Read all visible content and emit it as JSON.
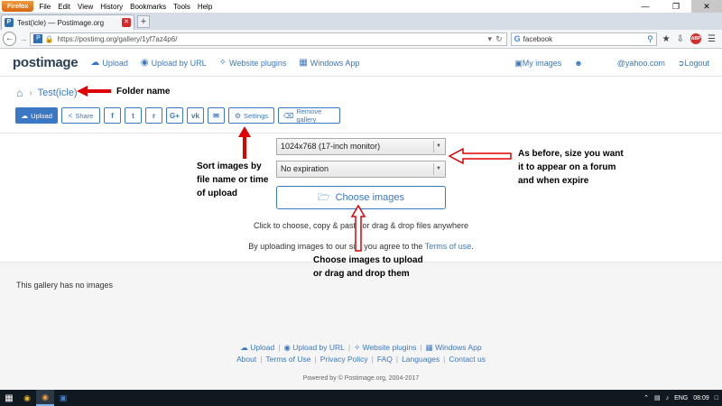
{
  "browser": {
    "button": "Firefox",
    "menu": [
      "File",
      "Edit",
      "View",
      "History",
      "Bookmarks",
      "Tools",
      "Help"
    ],
    "tab_title": "Test(icle) — Postimage.org",
    "url": "https://postimg.org/gallery/1yf7az4p6/",
    "search_query": "facebook",
    "search_engine_glyph": "G"
  },
  "site": {
    "logo": "postimage",
    "nav": {
      "upload": "Upload",
      "upload_by_url": "Upload by URL",
      "website_plugins": "Website plugins",
      "windows_app": "Windows App",
      "my_images": "My images",
      "account": "@yahoo.com",
      "logout": "Logout"
    }
  },
  "gallery": {
    "folder_name": "Test(icle)",
    "toolbar": {
      "upload": "Upload",
      "share": "Share",
      "settings": "Settings",
      "remove": "Remove gallery",
      "social": [
        "f",
        "t",
        "r",
        "G+",
        "vk",
        "✉"
      ]
    },
    "resize_option": "1024x768 (17-inch monitor)",
    "expiration_option": "No expiration",
    "choose_button": "Choose images",
    "hint": "Click to choose, copy & paste or drag & drop files anywhere",
    "terms_prefix": "By uploading images to our site you agree to the ",
    "terms_link": "Terms of use",
    "terms_suffix": ".",
    "empty_message": "This gallery has no images"
  },
  "footer": {
    "row1": [
      "Upload",
      "Upload by URL",
      "Website plugins",
      "Windows App"
    ],
    "row2": [
      "About",
      "Terms of Use",
      "Privacy Policy",
      "FAQ",
      "Languages",
      "Contact us"
    ],
    "powered": "Powered by © Postimage.org, 2004-2017"
  },
  "annotations": {
    "folder": "Folder name",
    "sort_line1": "Sort images by",
    "sort_line2": "file name or time",
    "sort_line3": "of upload",
    "size_line1": "As before, size you want",
    "size_line2": "it to appear on a forum",
    "size_line3": "and when expire",
    "choose_line1": "Choose images to upload",
    "choose_line2": "or drag and drop them",
    "color": "#e00000"
  },
  "taskbar": {
    "language": "ENG",
    "time": "08:09"
  }
}
